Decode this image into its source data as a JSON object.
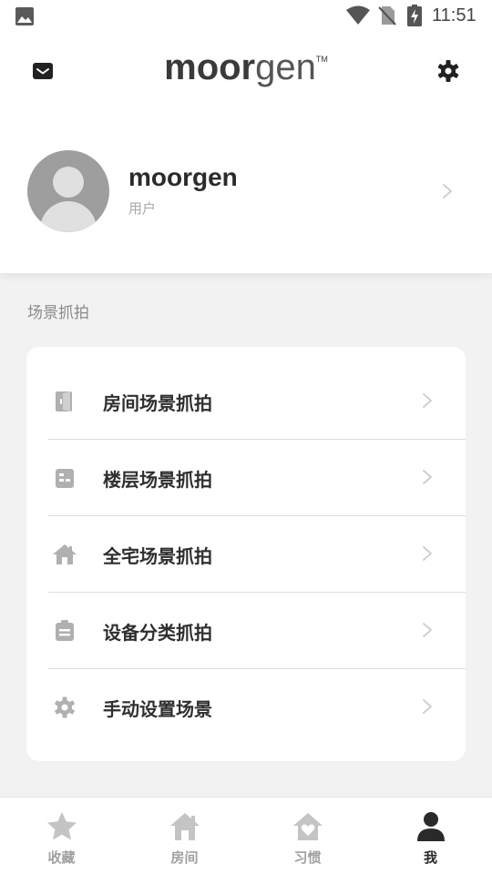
{
  "status_bar": {
    "time": "11:51",
    "icons": [
      "gallery-icon",
      "wifi-icon",
      "no-sim-icon",
      "battery-charging-icon"
    ]
  },
  "header": {
    "logo_bold": "moor",
    "logo_light": "gen",
    "logo_tm": "TM",
    "left_icon": "mail-icon",
    "right_icon": "gear-icon"
  },
  "profile": {
    "name": "moorgen",
    "role": "用户"
  },
  "section": {
    "title": "场景抓拍",
    "items": [
      {
        "label": "房间场景抓拍",
        "icon": "door-icon"
      },
      {
        "label": "楼层场景抓拍",
        "icon": "floor-icon"
      },
      {
        "label": "全宅场景抓拍",
        "icon": "house-icon"
      },
      {
        "label": "设备分类抓拍",
        "icon": "clipboard-icon"
      },
      {
        "label": "手动设置场景",
        "icon": "gear-icon"
      }
    ]
  },
  "bottom_nav": {
    "tabs": [
      {
        "label": "收藏",
        "icon": "star-icon",
        "active": false
      },
      {
        "label": "房间",
        "icon": "home-icon",
        "active": false
      },
      {
        "label": "习惯",
        "icon": "heart-home-icon",
        "active": false
      },
      {
        "label": "我",
        "icon": "person-icon",
        "active": true
      }
    ]
  },
  "colors": {
    "background": "#f2f2f2",
    "card": "#ffffff",
    "text_primary": "#2f2f2f",
    "text_secondary": "#a8a8a8",
    "icon_gray": "#b0b0b0",
    "active_tab": "#2a2a2a"
  }
}
